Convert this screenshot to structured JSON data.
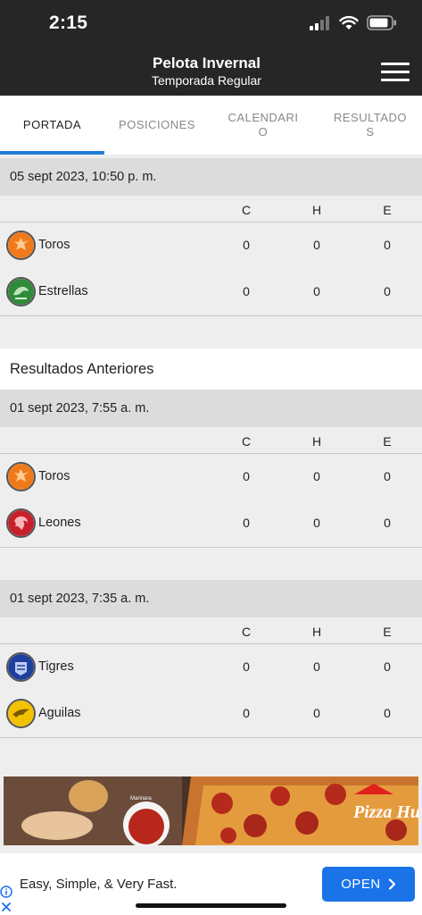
{
  "status": {
    "time": "2:15"
  },
  "header": {
    "title": "Pelota Invernal",
    "subtitle": "Temporada Regular",
    "menu_icon": "hamburger-menu-icon"
  },
  "tabs": [
    {
      "label": "PORTADA",
      "active": true
    },
    {
      "label": "POSICIONES",
      "active": false
    },
    {
      "label": "CALENDARI\nO",
      "active": false
    },
    {
      "label": "RESULTADO\nS",
      "active": false
    }
  ],
  "columns": {
    "c": "C",
    "h": "H",
    "e": "E"
  },
  "current_game": {
    "date": "05 sept 2023, 10:50 p. m.",
    "teams": [
      {
        "name": "Toros",
        "c": "0",
        "h": "0",
        "e": "0",
        "color": "#f07a1a"
      },
      {
        "name": "Estrellas",
        "c": "0",
        "h": "0",
        "e": "0",
        "color": "#2e8b3a"
      }
    ]
  },
  "previous": {
    "heading": "Resultados Anteriores",
    "games": [
      {
        "date": "01 sept 2023, 7:55 a. m.",
        "teams": [
          {
            "name": "Toros",
            "c": "0",
            "h": "0",
            "e": "0",
            "color": "#f07a1a"
          },
          {
            "name": "Leones",
            "c": "0",
            "h": "0",
            "e": "0",
            "color": "#c8202a"
          }
        ]
      },
      {
        "date": "01 sept 2023, 7:35 a. m.",
        "teams": [
          {
            "name": "Tigres",
            "c": "0",
            "h": "0",
            "e": "0",
            "color": "#1e3f9c"
          },
          {
            "name": "Aguilas",
            "c": "0",
            "h": "0",
            "e": "0",
            "color": "#f2c200"
          }
        ]
      }
    ]
  },
  "ad": {
    "banner_brand": "Pizza Hut",
    "banner_small_text": "Marinara",
    "text": "Easy, Simple, & Very Fast.",
    "button_label": "OPEN"
  }
}
